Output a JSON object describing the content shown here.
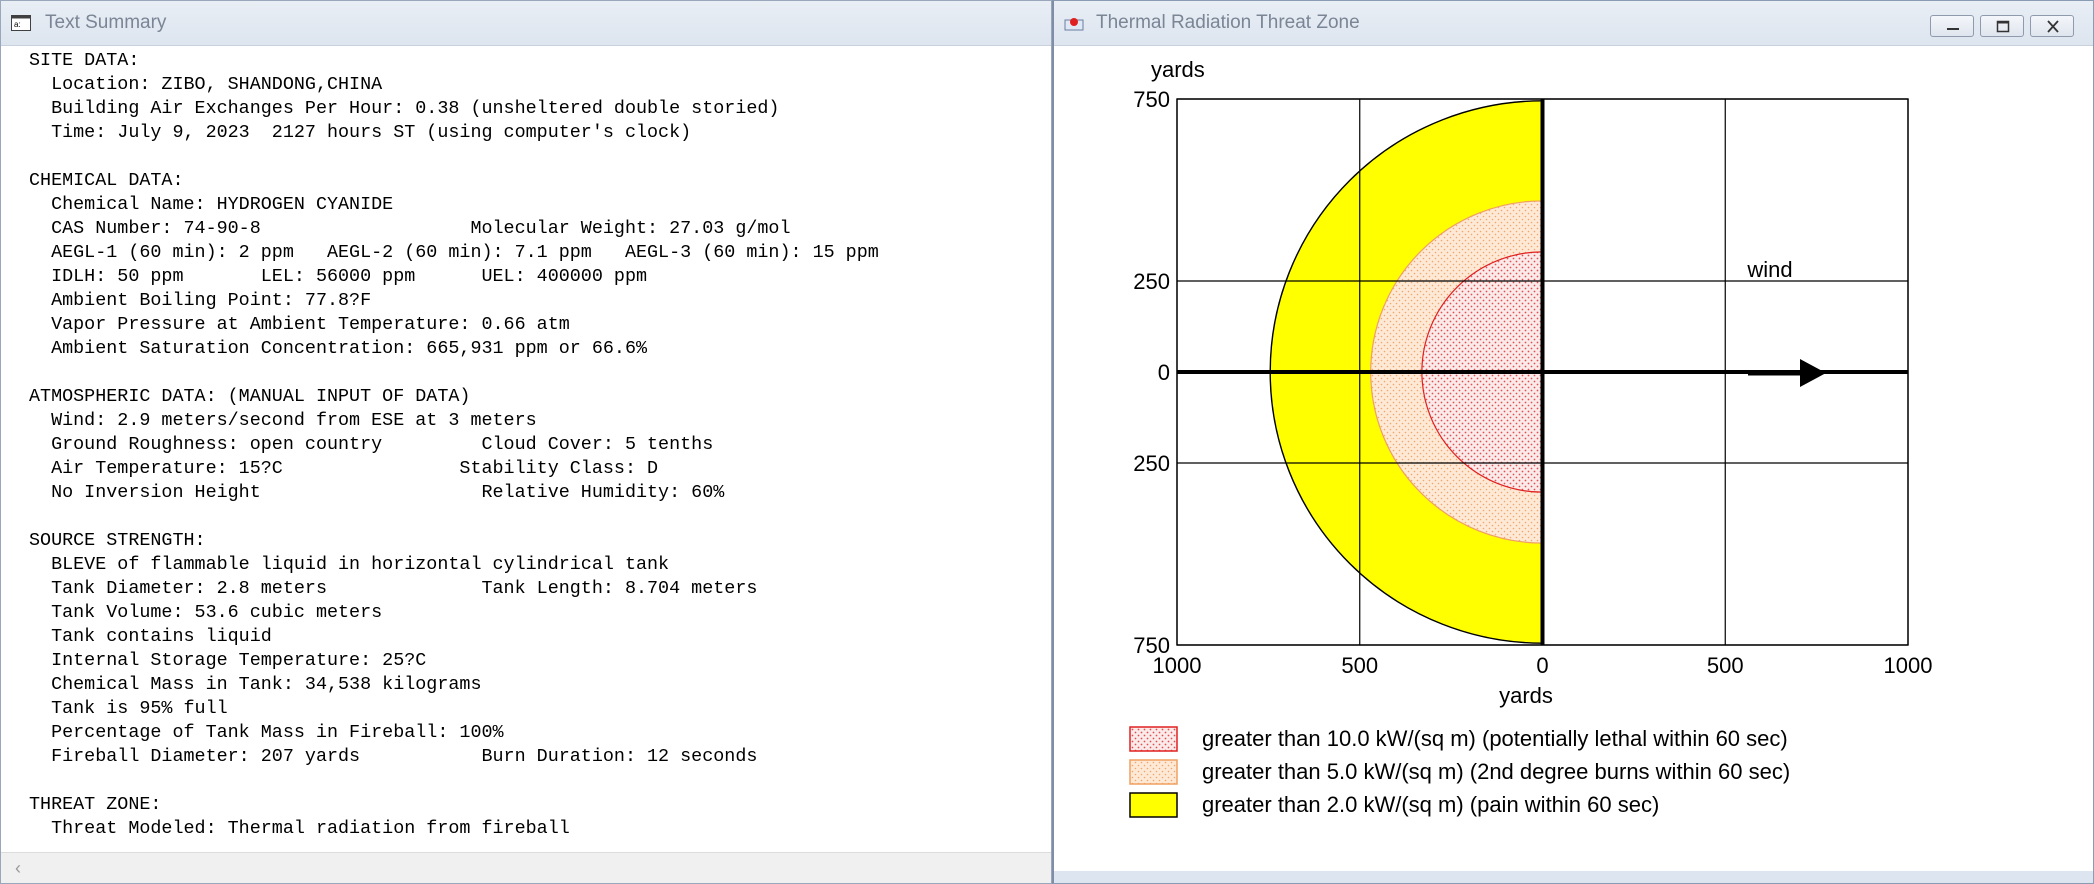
{
  "text_window": {
    "title": "Text Summary",
    "icon": "terminal-icon",
    "lines": [
      "SITE DATA:",
      "  Location: ZIBO, SHANDONG,CHINA",
      "  Building Air Exchanges Per Hour: 0.38 (unsheltered double storied)",
      "  Time: July 9, 2023  2127 hours ST (using computer's clock)",
      "",
      "CHEMICAL DATA:",
      "  Chemical Name: HYDROGEN CYANIDE",
      "  CAS Number: 74-90-8                   Molecular Weight: 27.03 g/mol",
      "  AEGL-1 (60 min): 2 ppm   AEGL-2 (60 min): 7.1 ppm   AEGL-3 (60 min): 15 ppm",
      "  IDLH: 50 ppm       LEL: 56000 ppm      UEL: 400000 ppm",
      "  Ambient Boiling Point: 77.8?F",
      "  Vapor Pressure at Ambient Temperature: 0.66 atm",
      "  Ambient Saturation Concentration: 665,931 ppm or 66.6%",
      "",
      "ATMOSPHERIC DATA: (MANUAL INPUT OF DATA)",
      "  Wind: 2.9 meters/second from ESE at 3 meters",
      "  Ground Roughness: open country         Cloud Cover: 5 tenths",
      "  Air Temperature: 15?C                Stability Class: D",
      "  No Inversion Height                    Relative Humidity: 60%",
      "",
      "SOURCE STRENGTH:",
      "  BLEVE of flammable liquid in horizontal cylindrical tank",
      "  Tank Diameter: 2.8 meters              Tank Length: 8.704 meters",
      "  Tank Volume: 53.6 cubic meters",
      "  Tank contains liquid",
      "  Internal Storage Temperature: 25?C",
      "  Chemical Mass in Tank: 34,538 kilograms",
      "  Tank is 95% full",
      "  Percentage of Tank Mass in Fireball: 100%",
      "  Fireball Diameter: 207 yards           Burn Duration: 12 seconds",
      "",
      "THREAT ZONE:",
      "  Threat Modeled: Thermal radiation from fireball"
    ]
  },
  "threat_window": {
    "title": "Thermal Radiation Threat Zone",
    "icon": "threat-zone-app-icon",
    "buttons": [
      "minimize-icon",
      "maximize-icon",
      "close-icon"
    ],
    "y_unit_label": "yards",
    "x_unit_label": "yards",
    "wind_label": "wind",
    "y_tick_labels": [
      "750",
      "250",
      "0",
      "250",
      "750"
    ],
    "x_tick_labels": [
      "1000",
      "500",
      "0",
      "500",
      "1000"
    ],
    "legend": [
      {
        "label": "greater than 10.0 kW/(sq m) (potentially lethal within 60 sec)",
        "fill": "#fbeaea",
        "dots": "#e05050",
        "stroke": "#e02020"
      },
      {
        "label": "greater than 5.0 kW/(sq m) (2nd degree burns within 60 sec)",
        "fill": "#fbe4cf",
        "dots": "#f0a060",
        "stroke": "#f0a060"
      },
      {
        "label": "greater than 2.0 kW/(sq m) (pain within 60 sec)",
        "fill": "#ffff00",
        "dots": "",
        "stroke": "#000000"
      }
    ]
  },
  "chart_data": {
    "type": "threat-zone",
    "x_ticks": [
      -1000,
      -500,
      0,
      500,
      1000
    ],
    "y_ticks": [
      750,
      250,
      0,
      -250,
      -750
    ],
    "xlim": [
      -1000,
      1000
    ],
    "ylim": [
      -750,
      750
    ],
    "zones": [
      {
        "level_kw_per_sq_m": 2.0,
        "radius_yards": 745,
        "color": "#ffff00"
      },
      {
        "level_kw_per_sq_m": 5.0,
        "radius_yards": 470,
        "color": "#fbe4cf"
      },
      {
        "level_kw_per_sq_m": 10.0,
        "radius_yards": 330,
        "color": "#fbeaea"
      }
    ]
  }
}
